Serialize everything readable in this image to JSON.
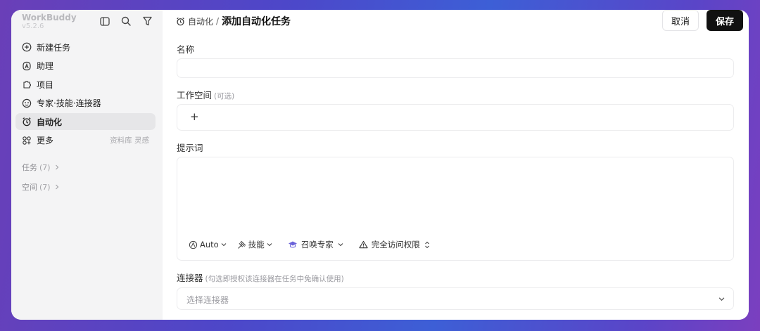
{
  "app": {
    "name": "WorkBuddy",
    "version": "v5.2.6"
  },
  "sidebar": {
    "items": [
      {
        "label": "新建任务",
        "icon": "plus-circle-icon"
      },
      {
        "label": "助理",
        "icon": "assistant-icon"
      },
      {
        "label": "项目",
        "icon": "puzzle-icon"
      },
      {
        "label": "专家·技能·连接器",
        "icon": "expert-icon"
      },
      {
        "label": "自动化",
        "icon": "alarm-clock-icon",
        "active": true
      },
      {
        "label": "更多",
        "icon": "grid-icon",
        "hint": "资料库 灵感"
      }
    ],
    "groups": [
      {
        "label": "任务",
        "count": "(7)"
      },
      {
        "label": "空间",
        "count": "(7)"
      }
    ]
  },
  "header": {
    "breadcrumb_parent": "自动化",
    "breadcrumb_sep": "/",
    "breadcrumb_current": "添加自动化任务",
    "cancel_label": "取消",
    "save_label": "保存"
  },
  "form": {
    "name_label": "名称",
    "name_value": "",
    "workspace_label": "工作空间",
    "workspace_sub": "(可选)",
    "workspace_add": "+",
    "prompt_label": "提示词",
    "prompt_toolbar": {
      "model": "Auto",
      "skills": "技能",
      "expert": "召唤专家",
      "access": "完全访问权限"
    },
    "connector_label": "连接器",
    "connector_sub": "(勾选即授权该连接器在任务中免确认使用)",
    "connector_placeholder": "选择连接器"
  },
  "colors": {
    "accent_dark": "#111111",
    "sidebar_bg": "#f4f4f5",
    "active_item_bg": "#e6e6e8",
    "expert_icon": "#6b63d9"
  }
}
